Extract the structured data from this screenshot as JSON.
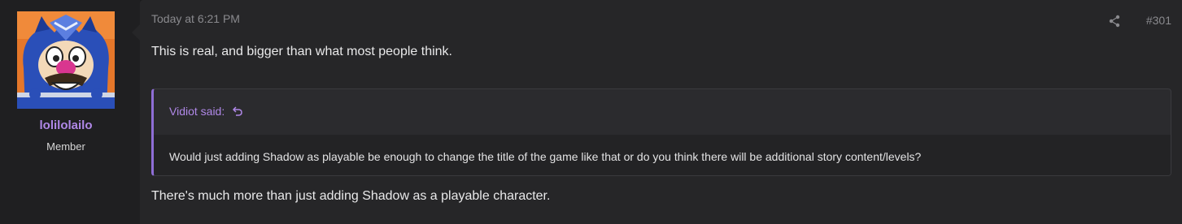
{
  "user": {
    "name": "lolilolailo",
    "title": "Member"
  },
  "post": {
    "timestamp": "Today at 6:21 PM",
    "number": "#301",
    "text_before_quote": "This is real, and bigger than what most people think.",
    "text_after_quote": "There's much more than just adding Shadow as a playable character."
  },
  "quote": {
    "attribution": "Vidiot said:",
    "text": "Would just adding Shadow as playable be enough to change the title of the game like that or do you think there will be additional story content/levels?"
  },
  "icons": {
    "share": "share-icon",
    "quote_jump": "return-arrow-icon"
  },
  "colors": {
    "accent": "#b088e8",
    "quote_border": "#8f6ed6",
    "post_background": "#262628",
    "user_cell_background": "#1f1f21"
  }
}
